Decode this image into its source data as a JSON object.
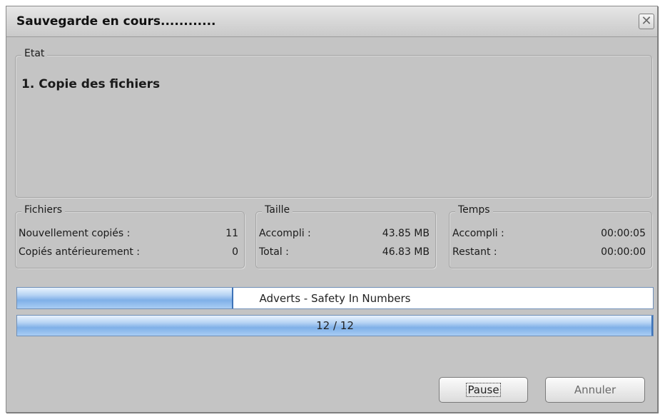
{
  "dialog": {
    "title": "Sauvegarde en cours............",
    "close_icon": "close-x-icon"
  },
  "etat": {
    "legend": "Etat",
    "step": "1. Copie des fichiers"
  },
  "fichiers": {
    "legend": "Fichiers",
    "rows": [
      {
        "label": "Nouvellement copiés :",
        "value": "11"
      },
      {
        "label": "Copiés antérieurement :",
        "value": "0"
      }
    ]
  },
  "taille": {
    "legend": "Taille",
    "rows": [
      {
        "label": "Accompli :",
        "value": "43.85 MB"
      },
      {
        "label": "Total :",
        "value": "46.83 MB"
      }
    ]
  },
  "temps": {
    "legend": "Temps",
    "rows": [
      {
        "label": "Accompli :",
        "value": "00:00:05"
      },
      {
        "label": "Restant :",
        "value": "00:00:00"
      }
    ]
  },
  "progress": {
    "file": {
      "label": "Adverts - Safety In Numbers",
      "fraction": 0.34
    },
    "total": {
      "label": "12 / 12",
      "fraction": 1.0
    }
  },
  "buttons": {
    "pause": "Pause",
    "cancel": "Annuler"
  },
  "colors": {
    "dialog_bg": "#c4c4c4",
    "progress_fill": "#7fb0e8",
    "progress_border": "#3e73b8"
  }
}
